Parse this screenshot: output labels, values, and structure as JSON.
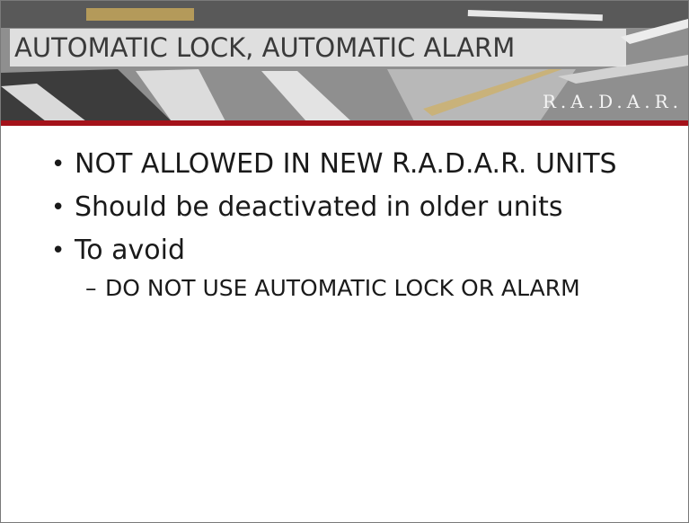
{
  "slide": {
    "title": "AUTOMATIC  LOCK, AUTOMATIC  ALARM",
    "logo": "R.A.D.A.R.",
    "bullets": [
      "NOT ALLOWED IN NEW R.A.D.A.R.  UNITS",
      "Should be deactivated in older units",
      "To avoid"
    ],
    "sub_bullets": [
      "DO NOT USE AUTOMATIC LOCK OR ALARM"
    ]
  },
  "colors": {
    "accent_red": "#a4121a",
    "title_bar": "#ebebeb"
  }
}
